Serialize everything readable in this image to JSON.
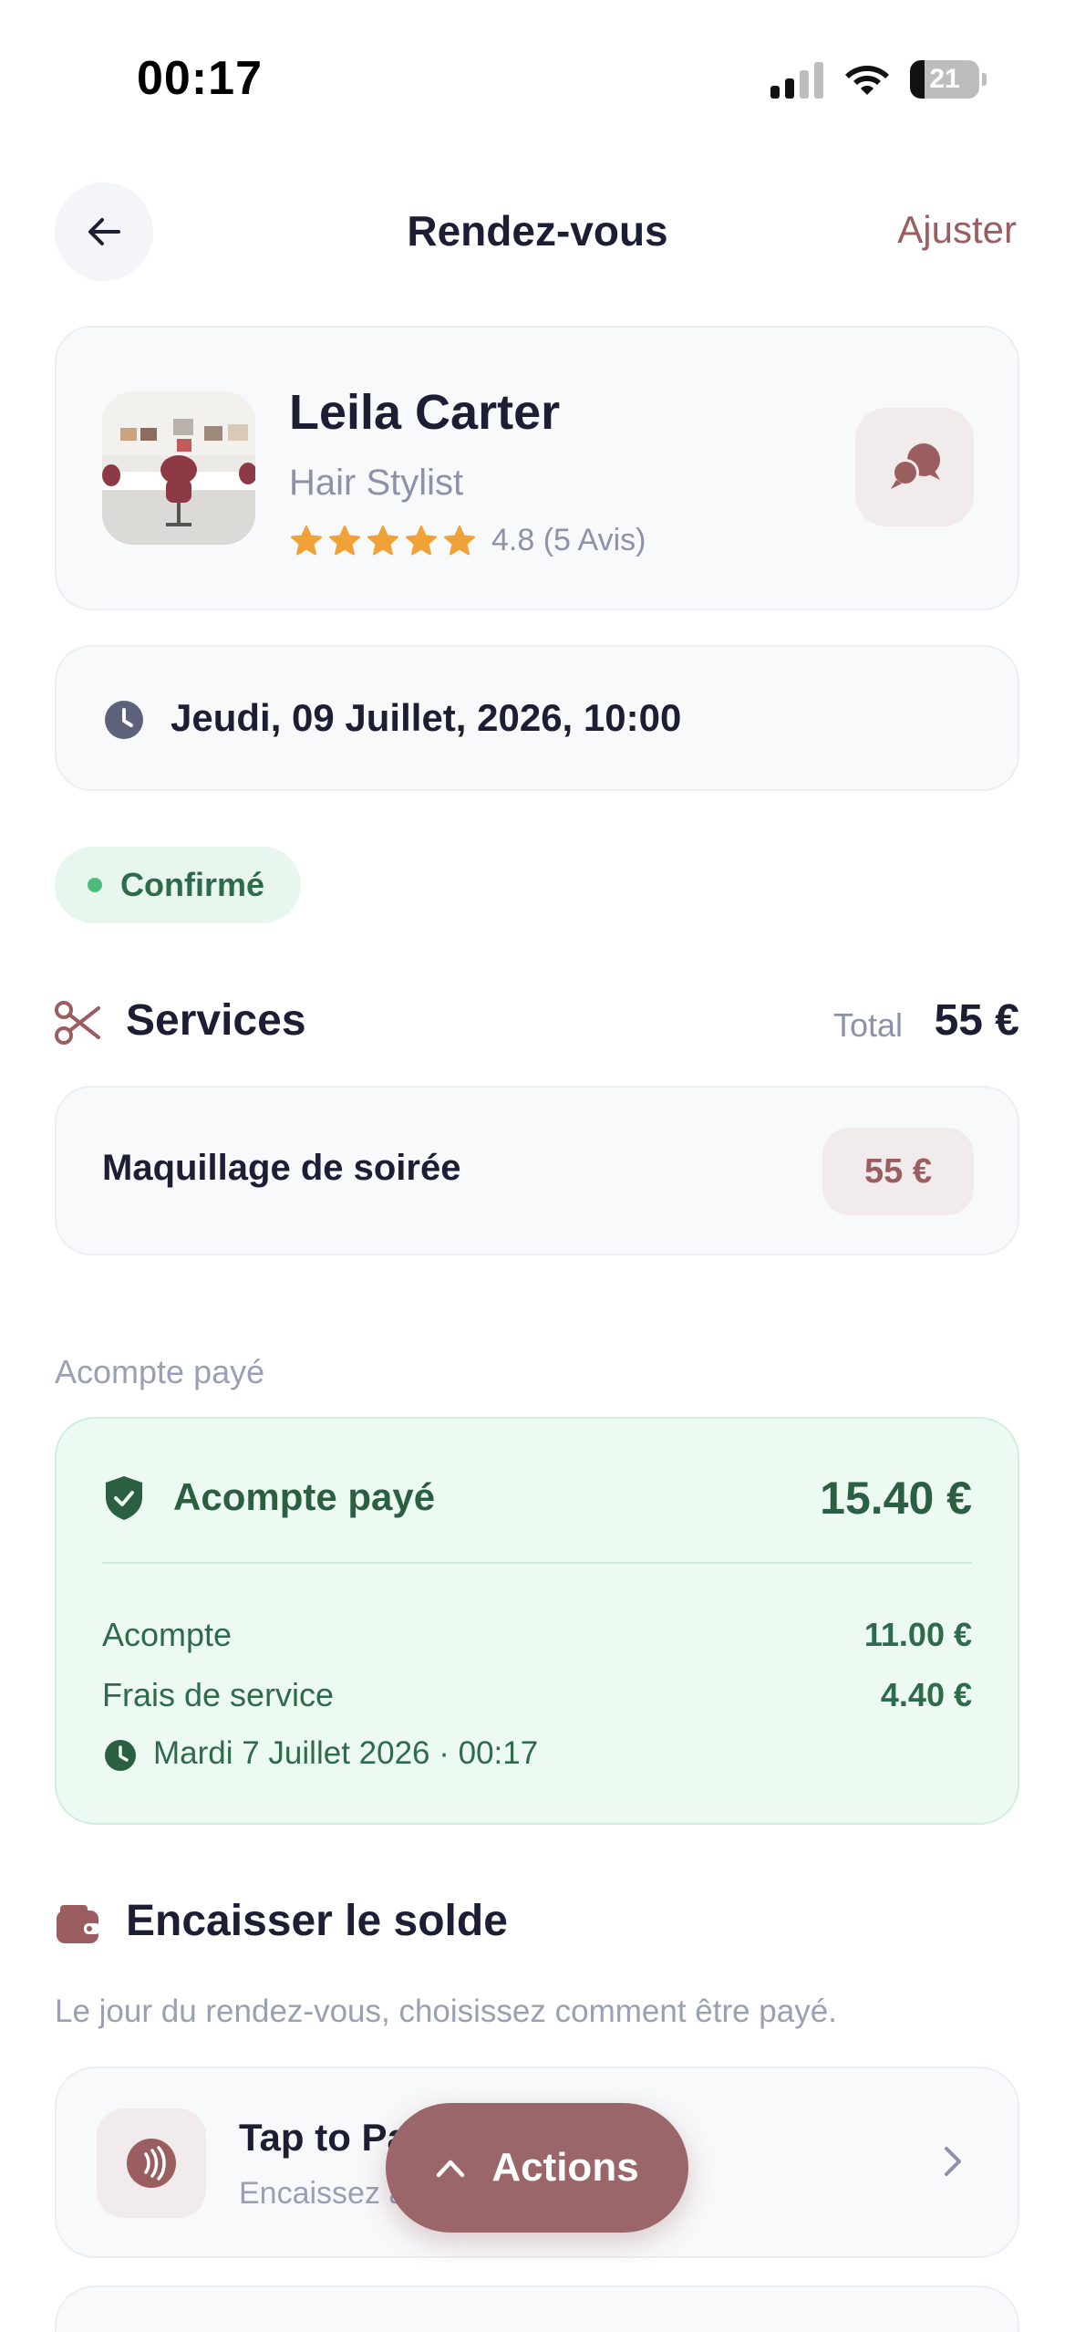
{
  "status_bar": {
    "time": "00:17",
    "battery_level": "21",
    "battery_fraction": 0.21
  },
  "header": {
    "title": "Rendez-vous",
    "adjust_label": "Ajuster",
    "back_icon": "arrow-left-icon"
  },
  "stylist": {
    "name": "Leila Carter",
    "role": "Hair Stylist",
    "rating": 4.8,
    "stars": 5,
    "rating_text": "4.8 (5 Avis)",
    "chat_icon": "chat-bubbles-icon"
  },
  "appointment": {
    "datetime": "Jeudi, 09 Juillet, 2026, 10:00",
    "status": "Confirmé"
  },
  "services": {
    "title": "Services",
    "total_label": "Total",
    "total_value": "55 €",
    "items": [
      {
        "name": "Maquillage de soirée",
        "price": "55 €"
      }
    ]
  },
  "deposit": {
    "caption": "Acompte payé",
    "title": "Acompte payé",
    "total": "15.40 €",
    "rows": [
      {
        "label": "Acompte",
        "value": "11.00 €"
      },
      {
        "label": "Frais de service",
        "value": "4.40 €"
      }
    ],
    "paid_at": "Mardi 7 Juillet 2026 · 00:17"
  },
  "balance": {
    "title": "Encaisser le solde",
    "subtitle": "Le jour du rendez-vous, choisissez comment être payé.",
    "options": [
      {
        "title": "Tap to Pay",
        "subtitle": "Encaissez avec votre téléphone",
        "icon": "contactless-icon"
      }
    ]
  },
  "fab": {
    "label": "Actions",
    "icon": "chevron-up-icon"
  },
  "colors": {
    "accent": "#9a5e60",
    "fab": "#9a6669",
    "star": "#f0a238",
    "success_bg": "#edfaf2",
    "success_text": "#2b5f42"
  }
}
